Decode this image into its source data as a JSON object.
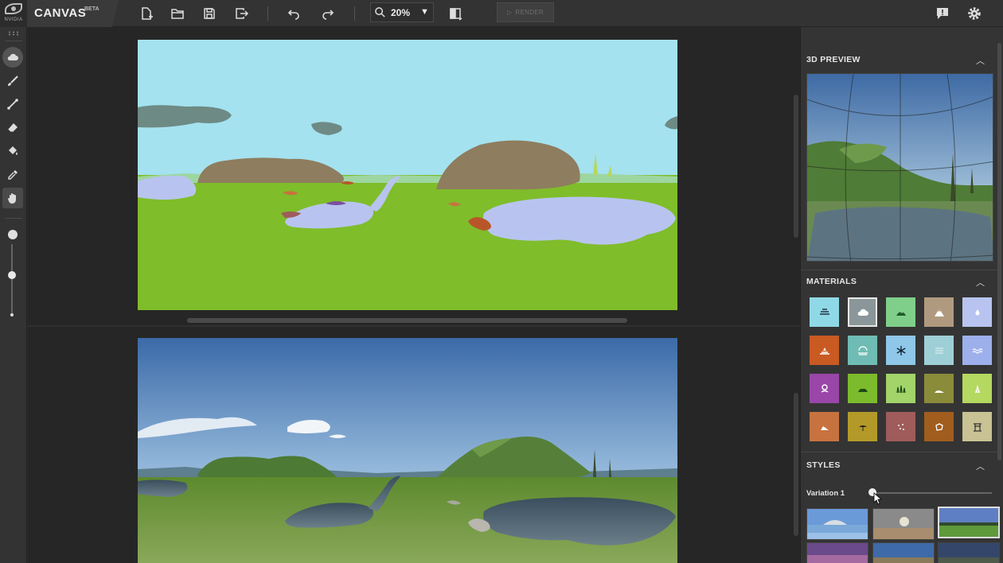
{
  "app": {
    "title": "CANVAS",
    "badge": "BETA",
    "logo_text": "NVIDIA"
  },
  "toolbar": {
    "zoom_value": "20%",
    "render_label": "RENDER",
    "icons": [
      "new-file-icon",
      "open-folder-icon",
      "save-icon",
      "export-icon",
      "undo-icon",
      "redo-icon",
      "zoom-icon",
      "compare-split-icon",
      "feedback-icon",
      "gear-icon"
    ]
  },
  "tools": [
    "cloud-material-icon",
    "brush-icon",
    "line-icon",
    "eraser-icon",
    "paint-bucket-icon",
    "eyedropper-icon",
    "hand-icon"
  ],
  "brush_size_level": 0.5,
  "panel": {
    "preview_title": "3D PREVIEW",
    "materials_title": "MATERIALS",
    "styles_title": "STYLES",
    "variation_label": "Variation 1",
    "variation_level": 0.0
  },
  "materials": [
    {
      "name": "sea-icon",
      "color": "#8fd9e6"
    },
    {
      "name": "cloud-icon",
      "color": "#8a9699",
      "selected": true
    },
    {
      "name": "grass-hill-icon",
      "color": "#7fcf8a"
    },
    {
      "name": "mountain-icon",
      "color": "#b09a7f"
    },
    {
      "name": "drop-icon",
      "color": "#b8c4ef"
    },
    {
      "name": "dirt-icon",
      "color": "#c85a22"
    },
    {
      "name": "fog-icon",
      "color": "#6fbcb4"
    },
    {
      "name": "snow-icon",
      "color": "#8ec7e8"
    },
    {
      "name": "sky-icon",
      "color": "#9ecfd6"
    },
    {
      "name": "water-icon",
      "color": "#9db0ec"
    },
    {
      "name": "flower-icon",
      "color": "#9946a8"
    },
    {
      "name": "bush-icon",
      "color": "#7cbb2c"
    },
    {
      "name": "grass-icon",
      "color": "#a2d46a"
    },
    {
      "name": "hill-icon",
      "color": "#8a8c3a"
    },
    {
      "name": "tree-icon",
      "color": "#b4d860"
    },
    {
      "name": "rock-icon",
      "color": "#c8723f"
    },
    {
      "name": "sand-icon",
      "color": "#b39a28"
    },
    {
      "name": "gravel-icon",
      "color": "#a05b5b"
    },
    {
      "name": "stone-icon",
      "color": "#a05d1e"
    },
    {
      "name": "structure-icon",
      "color": "#c8c294"
    }
  ],
  "colors": {
    "grass": "#7fbd2a",
    "sky": "#a4e2ef",
    "water": "#b8c4ef",
    "cloud": "#6e8a84",
    "mountain": "#8e7d5e"
  }
}
